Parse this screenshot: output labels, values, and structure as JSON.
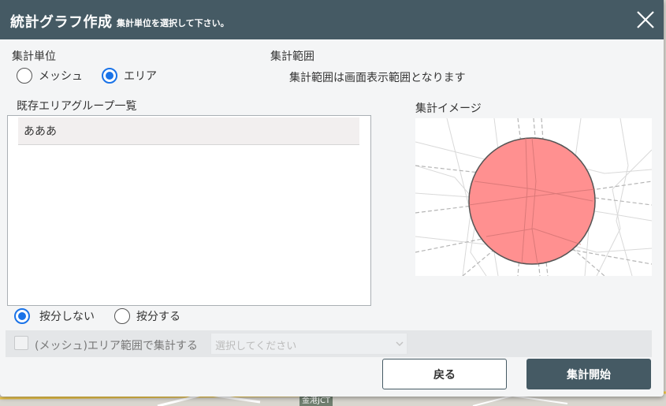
{
  "dialog": {
    "title": "統計グラフ作成",
    "subtitle": "集計単位を選択して下さい。"
  },
  "unit": {
    "label": "集計単位",
    "options": [
      {
        "label": "メッシュ",
        "selected": false
      },
      {
        "label": "エリア",
        "selected": true
      }
    ]
  },
  "range": {
    "label": "集計範囲",
    "note": "集計範囲は画面表示範囲となります"
  },
  "groups": {
    "label": "既存エリアグループ一覧",
    "items": [
      "あああ"
    ]
  },
  "preview": {
    "label": "集計イメージ"
  },
  "apportion": {
    "options": [
      {
        "label": "按分しない",
        "selected": true
      },
      {
        "label": "按分する",
        "selected": false
      }
    ]
  },
  "mesh_area": {
    "checkbox_label": "(メッシュ)エリア範囲で集計する",
    "checked": false,
    "select_placeholder": "選択してください"
  },
  "buttons": {
    "back": "戻る",
    "start": "集計開始"
  },
  "background": {
    "map_label": "金港JCT"
  },
  "colors": {
    "header": "#455a64",
    "accent": "#1a73e8",
    "circle_fill": "#ff9090"
  },
  "icons": {
    "close": "close-icon",
    "select": "chevron-down-icon"
  }
}
